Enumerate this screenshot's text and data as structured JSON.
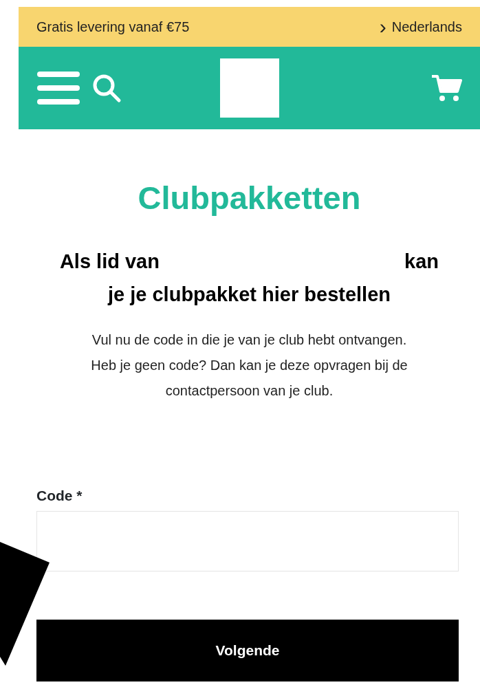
{
  "top_bar": {
    "shipping_note": "Gratis levering vanaf €75",
    "language_arrow": "›",
    "language": "Nederlands"
  },
  "title": "Clubpakketten",
  "heading": {
    "before": "Als lid van",
    "after": "kan je je clubpakket hier bestellen"
  },
  "intro": "Vul nu de code in die je van je club hebt ontvangen. Heb je geen code? Dan kan je deze opvragen bij de contactpersoon van je club.",
  "form": {
    "label": "Code *"
  },
  "buttons": [
    {
      "label": "Volgende"
    }
  ]
}
